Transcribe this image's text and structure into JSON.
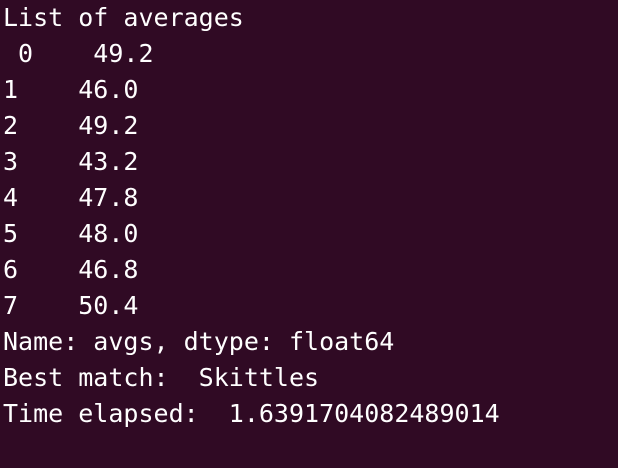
{
  "window": {
    "background": "#300A24",
    "foreground": "#FFFFFF"
  },
  "terminal": {
    "lines": [
      "List of averages",
      " 0    49.2",
      "1    46.0",
      "2    49.2",
      "3    43.2",
      "4    47.8",
      "5    48.0",
      "6    46.8",
      "7    50.4",
      "Name: avgs, dtype: float64",
      "Best match:  Skittles",
      "Time elapsed:  1.6391704082489014"
    ]
  }
}
